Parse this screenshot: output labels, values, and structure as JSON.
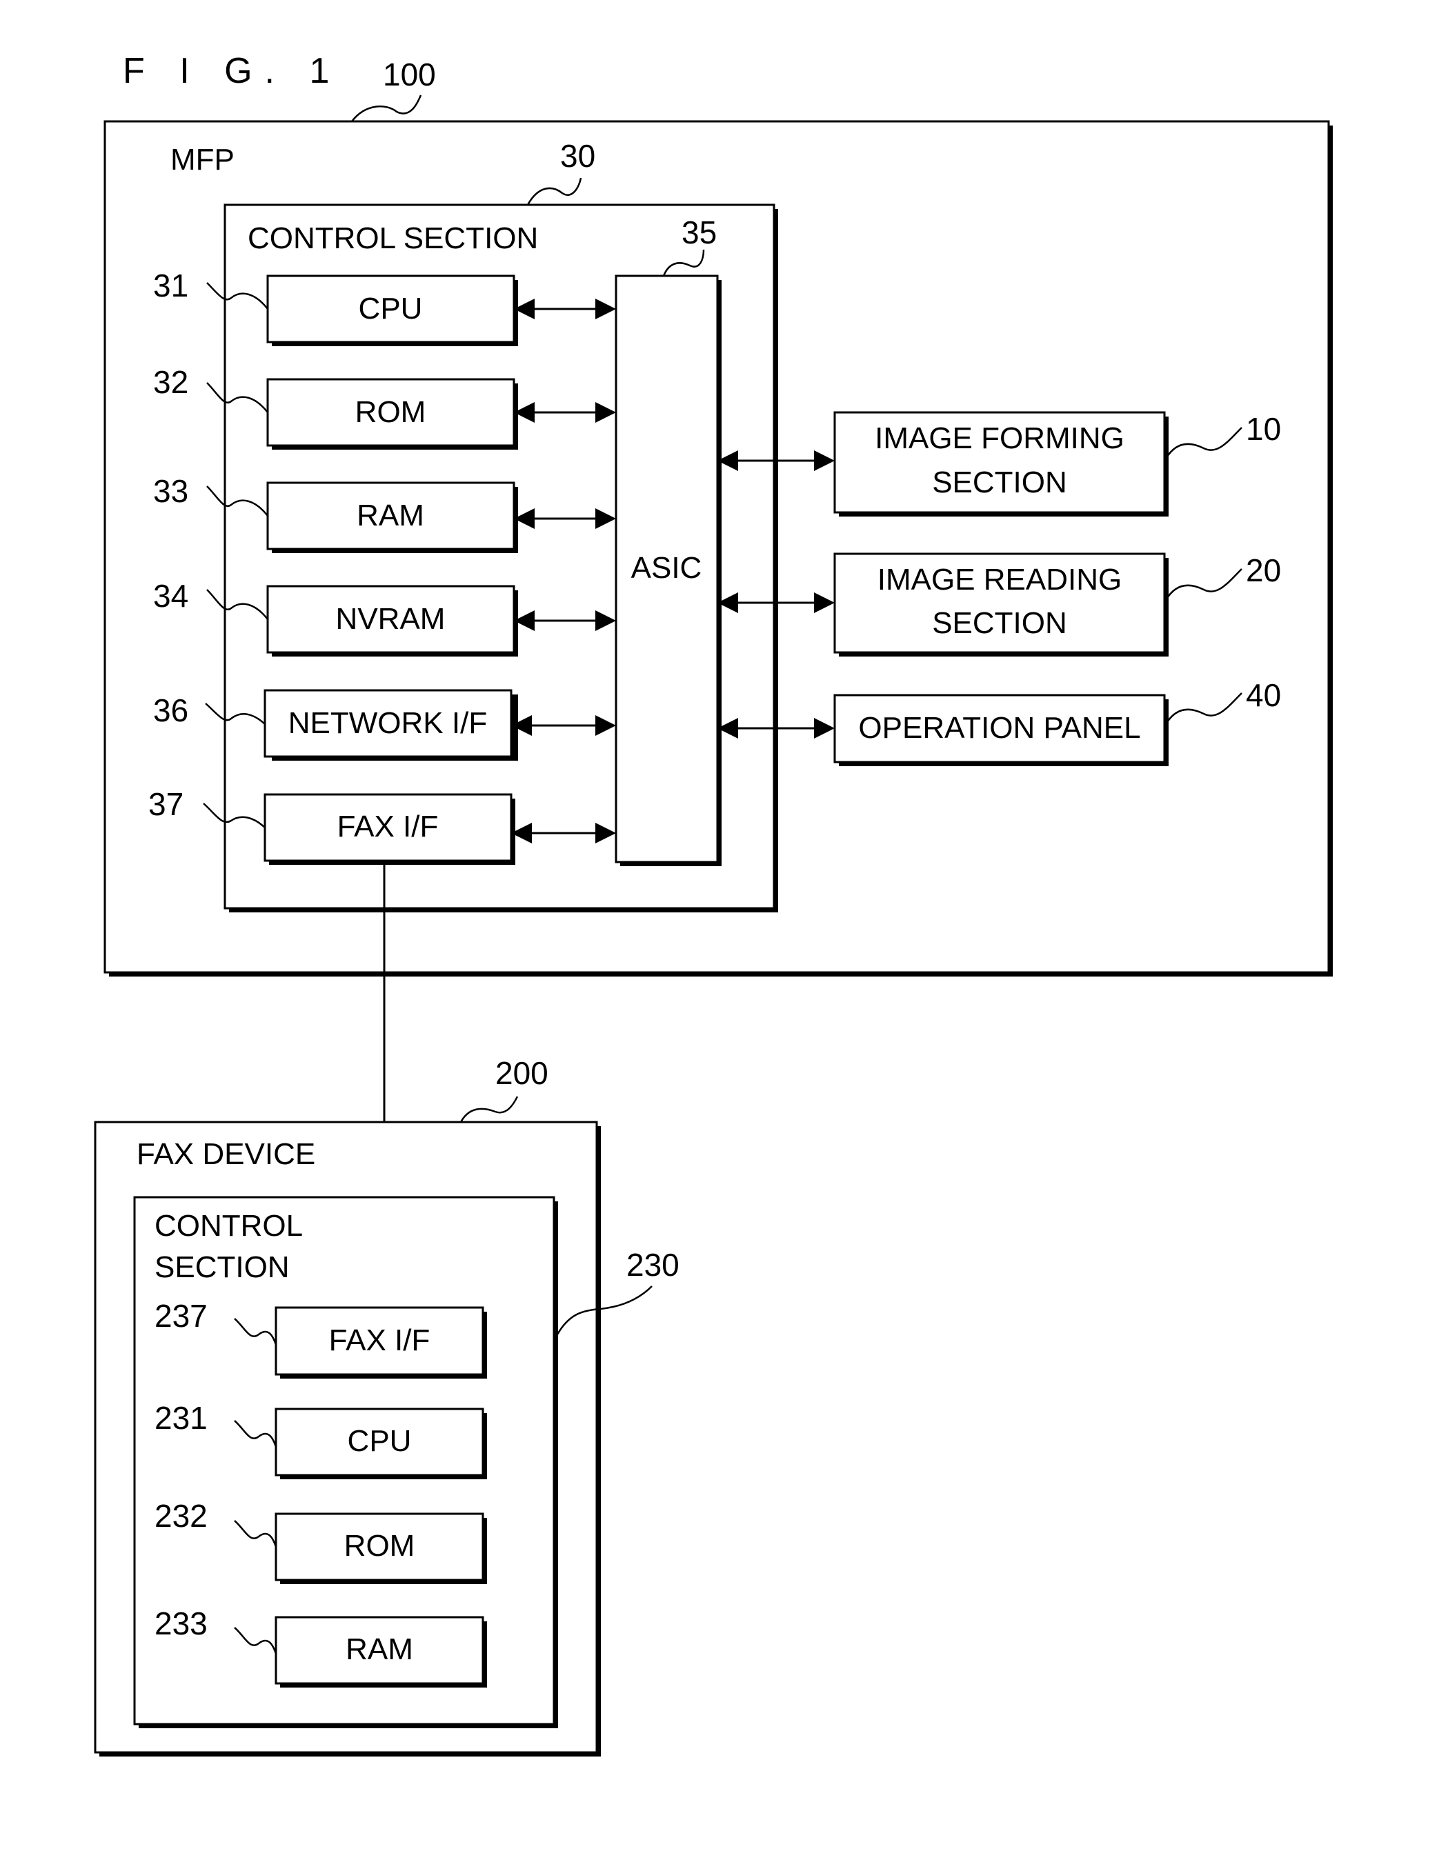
{
  "figure": {
    "title": "F I G. 1"
  },
  "mfp": {
    "ref": "100",
    "label": "MFP",
    "control_section": {
      "ref": "30",
      "label": "CONTROL SECTION",
      "asic": {
        "ref": "35",
        "label": "ASIC"
      },
      "components": [
        {
          "ref": "31",
          "label": "CPU"
        },
        {
          "ref": "32",
          "label": "ROM"
        },
        {
          "ref": "33",
          "label": "RAM"
        },
        {
          "ref": "34",
          "label": "NVRAM"
        },
        {
          "ref": "36",
          "label": "NETWORK I/F"
        },
        {
          "ref": "37",
          "label": "FAX I/F"
        }
      ]
    },
    "peripherals": [
      {
        "ref": "10",
        "label_line1": "IMAGE FORMING",
        "label_line2": "SECTION"
      },
      {
        "ref": "20",
        "label_line1": "IMAGE READING",
        "label_line2": "SECTION"
      },
      {
        "ref": "40",
        "label_line1": "OPERATION PANEL",
        "label_line2": ""
      }
    ]
  },
  "fax_device": {
    "ref": "200",
    "label": "FAX DEVICE",
    "control_section": {
      "ref": "230",
      "label_line1": "CONTROL",
      "label_line2": "SECTION",
      "components": [
        {
          "ref": "237",
          "label": "FAX I/F"
        },
        {
          "ref": "231",
          "label": "CPU"
        },
        {
          "ref": "232",
          "label": "ROM"
        },
        {
          "ref": "233",
          "label": "RAM"
        }
      ]
    }
  }
}
